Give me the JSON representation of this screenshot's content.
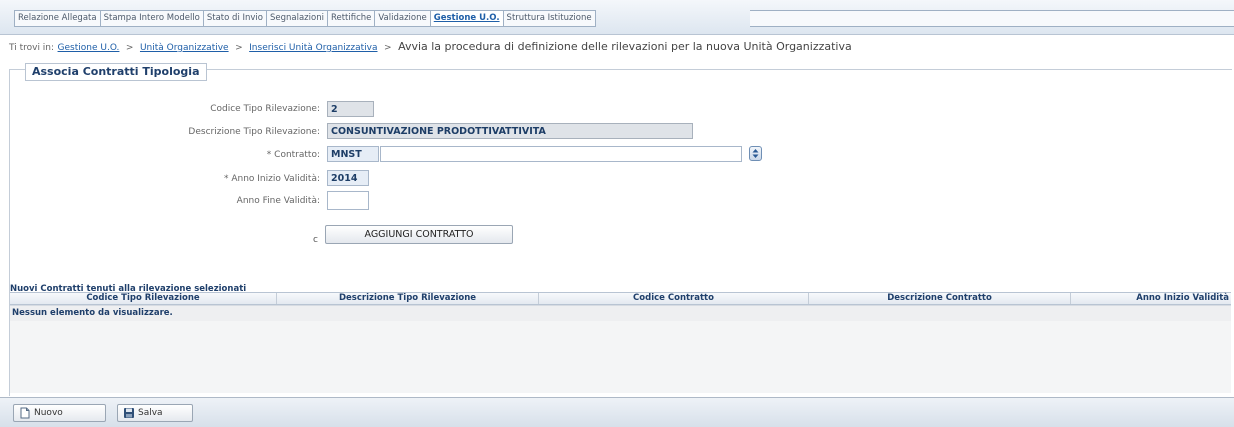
{
  "tabs": [
    {
      "label": "Relazione Allegata",
      "active": false
    },
    {
      "label": "Stampa Intero Modello",
      "active": false
    },
    {
      "label": "Stato di Invio",
      "active": false
    },
    {
      "label": "Segnalazioni",
      "active": false
    },
    {
      "label": "Rettifiche",
      "active": false
    },
    {
      "label": "Validazione",
      "active": false
    },
    {
      "label": "Gestione U.O.",
      "active": true
    },
    {
      "label": "Struttura Istituzione",
      "active": false
    }
  ],
  "breadcrumb": {
    "prefix": "Ti trovi in:",
    "links": [
      "Gestione U.O.",
      "Unità Organizzative",
      "Inserisci Unità Organizzativa"
    ],
    "separator": ">",
    "current": "Avvia la procedura di definizione delle rilevazioni per la nuova Unità Organizzativa"
  },
  "form": {
    "legend": "Associa Contratti Tipologia",
    "codice_tipo_label": "Codice Tipo Rilevazione:",
    "codice_tipo_value": "2",
    "descrizione_tipo_label": "Descrizione Tipo Rilevazione:",
    "descrizione_tipo_value": "CONSUNTIVAZIONE PRODOTTIVATTIVITA",
    "contratto_label": "* Contratto:",
    "contratto_code": "MNST",
    "contratto_desc": "",
    "anno_inizio_label": "* Anno Inizio Validità:",
    "anno_inizio_value": "2014",
    "anno_fine_label": "Anno Fine Validità:",
    "anno_fine_value": "",
    "radio_label": "c",
    "add_button": "AGGIUNGI CONTRATTO",
    "lookup_icon": "lookup-icon"
  },
  "table": {
    "title": "Nuovi Contratti tenuti alla rilevazione selezionati",
    "columns": [
      "Codice Tipo Rilevazione",
      "Descrizione Tipo Rilevazione",
      "Codice Contratto",
      "Descrizione Contratto",
      "Anno Inizio Validità"
    ],
    "empty_message": "Nessun elemento da visualizzare."
  },
  "toolbar": {
    "new_label": "Nuovo",
    "save_label": "Salva",
    "new_icon": "new-document-icon",
    "save_icon": "floppy-disk-icon"
  },
  "colors": {
    "accent": "#1f5fa8",
    "heading": "#1f3f6b"
  }
}
